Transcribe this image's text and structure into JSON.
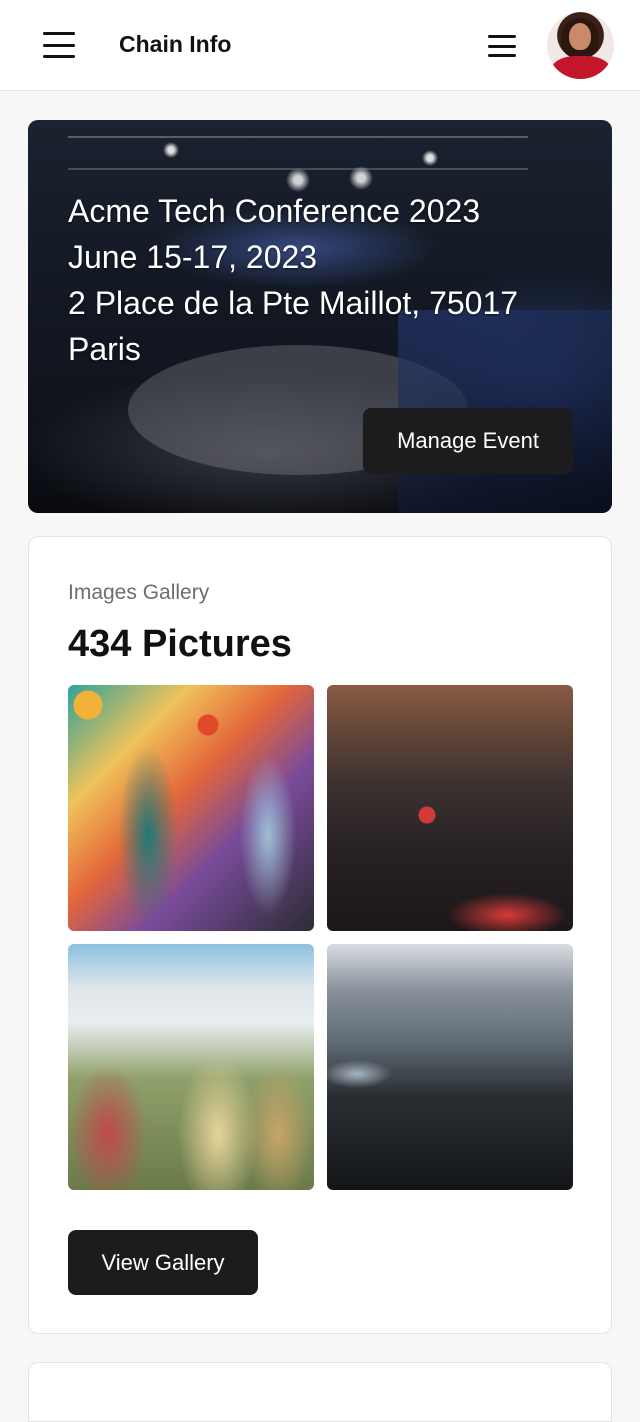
{
  "header": {
    "title": "Chain Info",
    "left_menu_icon": "hamburger-icon",
    "right_menu_icon": "hamburger-icon",
    "avatar": "user-avatar"
  },
  "event": {
    "name": "Acme Tech Conference 2023",
    "dates": "June 15-17, 2023",
    "address_line1": "2 Place de la Pte Maillot, 75017",
    "address_line2": "Paris",
    "manage_label": "Manage Event"
  },
  "gallery": {
    "label": "Images Gallery",
    "count_text": "434 Pictures",
    "view_label": "View Gallery"
  },
  "colors": {
    "button_bg": "#1c1c1e",
    "page_bg": "#f7f7f8",
    "card_bg": "#ffffff"
  }
}
